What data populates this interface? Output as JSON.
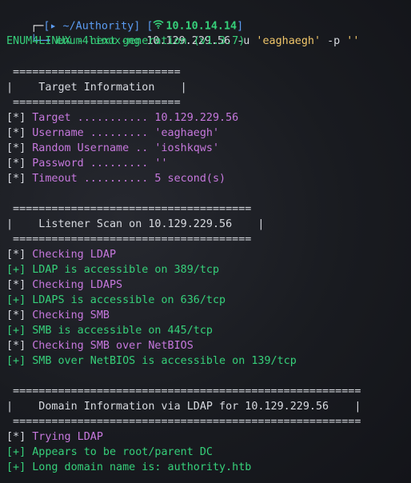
{
  "prompt": {
    "corner_top": "┌─",
    "bracket_open": "[",
    "arrow_glyph": "▸",
    "cwd": " ~/Authority",
    "bracket_close": "]",
    "ip_bracket_open": " [",
    "ip": "10.10.14.14",
    "ip_bracket_close": "]",
    "corner_bottom": "└─",
    "arrow": "╼",
    "command_name": " enum4linux-ng",
    "command_target": " 10.129.229.56",
    "command_user_flag": " -u",
    "command_user_value": " 'eaghaegh'",
    "command_pass_flag": " -p",
    "command_pass_value": " ''"
  },
  "banner": "ENUM4LINUX - next generation (v1.3.7)",
  "sections": [
    {
      "rule": " ==========================",
      "title": "|    Target Information    |",
      "rule_bottom": " =========================="
    },
    {
      "rule": " =====================================",
      "title": "|    Listener Scan on 10.129.229.56    |",
      "rule_bottom": " ====================================="
    },
    {
      "rule": " ======================================================",
      "title": "|    Domain Information via LDAP for 10.129.229.56    |",
      "rule_bottom": " ======================================================"
    }
  ],
  "target_info": [
    {
      "tag": "[*]",
      "label": " Target ...........",
      "value": " 10.129.229.56"
    },
    {
      "tag": "[*]",
      "label": " Username .........",
      "value": " 'eaghaegh'"
    },
    {
      "tag": "[*]",
      "label": " Random Username ..",
      "value": " 'ioshkqws'"
    },
    {
      "tag": "[*]",
      "label": " Password .........",
      "value": " ''"
    },
    {
      "tag": "[*]",
      "label": " Timeout ..........",
      "value": " 5 second(s)"
    }
  ],
  "listener_scan": [
    {
      "tag": "[*]",
      "text": " Checking LDAP",
      "kind": "info"
    },
    {
      "tag": "[+]",
      "text": " LDAP is accessible on 389/tcp",
      "kind": "ok"
    },
    {
      "tag": "[*]",
      "text": " Checking LDAPS",
      "kind": "info"
    },
    {
      "tag": "[+]",
      "text": " LDAPS is accessible on 636/tcp",
      "kind": "ok"
    },
    {
      "tag": "[*]",
      "text": " Checking SMB",
      "kind": "info"
    },
    {
      "tag": "[+]",
      "text": " SMB is accessible on 445/tcp",
      "kind": "ok"
    },
    {
      "tag": "[*]",
      "text": " Checking SMB over NetBIOS",
      "kind": "info"
    },
    {
      "tag": "[+]",
      "text": " SMB over NetBIOS is accessible on 139/tcp",
      "kind": "ok"
    }
  ],
  "domain_info": [
    {
      "tag": "[*]",
      "text": " Trying LDAP",
      "kind": "info"
    },
    {
      "tag": "[+]",
      "text": " Appears to be root/parent DC",
      "kind": "ok"
    },
    {
      "tag": "[+]",
      "text": " Long domain name is: authority.htb",
      "kind": "ok"
    }
  ],
  "colors": {
    "background": "#15171c",
    "prompt": "#5b9cf2",
    "ok": "#36d07a",
    "info": "#c678dd",
    "string": "#f0c66a"
  },
  "icons": {
    "wifi": "wifi-icon"
  }
}
